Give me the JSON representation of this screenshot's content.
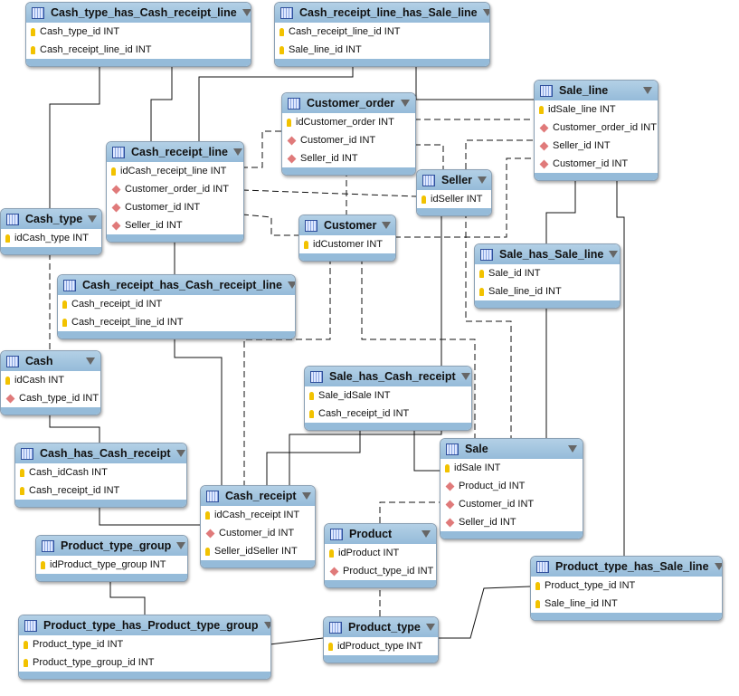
{
  "tables": [
    {
      "name": "Cash_type_has_Cash_receipt_line",
      "columns": [
        {
          "label": "Cash_type_id INT",
          "key": "pk"
        },
        {
          "label": "Cash_receipt_line_id INT",
          "key": "pk"
        }
      ]
    },
    {
      "name": "Cash_receipt_line_has_Sale_line",
      "columns": [
        {
          "label": "Cash_receipt_line_id INT",
          "key": "pk"
        },
        {
          "label": "Sale_line_id INT",
          "key": "pk"
        }
      ]
    },
    {
      "name": "Customer_order",
      "columns": [
        {
          "label": "idCustomer_order INT",
          "key": "pk"
        },
        {
          "label": "Customer_id INT",
          "key": "fk"
        },
        {
          "label": "Seller_id INT",
          "key": "fk"
        }
      ]
    },
    {
      "name": "Sale_line",
      "columns": [
        {
          "label": "idSale_line INT",
          "key": "pk"
        },
        {
          "label": "Customer_order_id INT",
          "key": "fk"
        },
        {
          "label": "Seller_id INT",
          "key": "fk"
        },
        {
          "label": "Customer_id INT",
          "key": "fk"
        }
      ]
    },
    {
      "name": "Cash_receipt_line",
      "columns": [
        {
          "label": "idCash_receipt_line INT",
          "key": "pk"
        },
        {
          "label": "Customer_order_id INT",
          "key": "fk"
        },
        {
          "label": "Customer_id INT",
          "key": "fk"
        },
        {
          "label": "Seller_id INT",
          "key": "fk"
        }
      ]
    },
    {
      "name": "Seller",
      "columns": [
        {
          "label": "idSeller INT",
          "key": "pk"
        }
      ]
    },
    {
      "name": "Cash_type",
      "columns": [
        {
          "label": "idCash_type INT",
          "key": "pk"
        }
      ]
    },
    {
      "name": "Customer",
      "columns": [
        {
          "label": "idCustomer INT",
          "key": "pk"
        }
      ]
    },
    {
      "name": "Sale_has_Sale_line",
      "columns": [
        {
          "label": "Sale_id INT",
          "key": "pk"
        },
        {
          "label": "Sale_line_id INT",
          "key": "pk"
        }
      ]
    },
    {
      "name": "Cash_receipt_has_Cash_receipt_line",
      "columns": [
        {
          "label": "Cash_receipt_id INT",
          "key": "pk"
        },
        {
          "label": "Cash_receipt_line_id INT",
          "key": "pk"
        }
      ]
    },
    {
      "name": "Cash",
      "columns": [
        {
          "label": "idCash INT",
          "key": "pk"
        },
        {
          "label": "Cash_type_id INT",
          "key": "fk"
        }
      ]
    },
    {
      "name": "Sale_has_Cash_receipt",
      "columns": [
        {
          "label": "Sale_idSale INT",
          "key": "pk"
        },
        {
          "label": "Cash_receipt_id INT",
          "key": "pk"
        }
      ]
    },
    {
      "name": "Sale",
      "columns": [
        {
          "label": "idSale INT",
          "key": "pk"
        },
        {
          "label": "Product_id INT",
          "key": "fk"
        },
        {
          "label": "Customer_id INT",
          "key": "fk"
        },
        {
          "label": "Seller_id INT",
          "key": "fk"
        }
      ]
    },
    {
      "name": "Cash_has_Cash_receipt",
      "columns": [
        {
          "label": "Cash_idCash INT",
          "key": "pk"
        },
        {
          "label": "Cash_receipt_id INT",
          "key": "pk"
        }
      ]
    },
    {
      "name": "Cash_receipt",
      "columns": [
        {
          "label": "idCash_receipt INT",
          "key": "pk"
        },
        {
          "label": "Customer_id INT",
          "key": "fk"
        },
        {
          "label": "Seller_idSeller INT",
          "key": "pk"
        }
      ]
    },
    {
      "name": "Product",
      "columns": [
        {
          "label": "idProduct INT",
          "key": "pk"
        },
        {
          "label": "Product_type_id INT",
          "key": "fk"
        }
      ]
    },
    {
      "name": "Product_type_group",
      "columns": [
        {
          "label": "idProduct_type_group INT",
          "key": "pk"
        }
      ]
    },
    {
      "name": "Product_type_has_Sale_line",
      "columns": [
        {
          "label": "Product_type_id INT",
          "key": "pk"
        },
        {
          "label": "Sale_line_id INT",
          "key": "pk"
        }
      ]
    },
    {
      "name": "Product_type_has_Product_type_group",
      "columns": [
        {
          "label": "Product_type_id INT",
          "key": "pk"
        },
        {
          "label": "Product_type_group_id INT",
          "key": "pk"
        }
      ]
    },
    {
      "name": "Product_type",
      "columns": [
        {
          "label": "idProduct_type INT",
          "key": "pk"
        }
      ]
    }
  ],
  "colors": {
    "header": "#95bbd9",
    "primary_key": "#f2c200",
    "foreign_key": "#e07a7a",
    "line": "#111111"
  }
}
